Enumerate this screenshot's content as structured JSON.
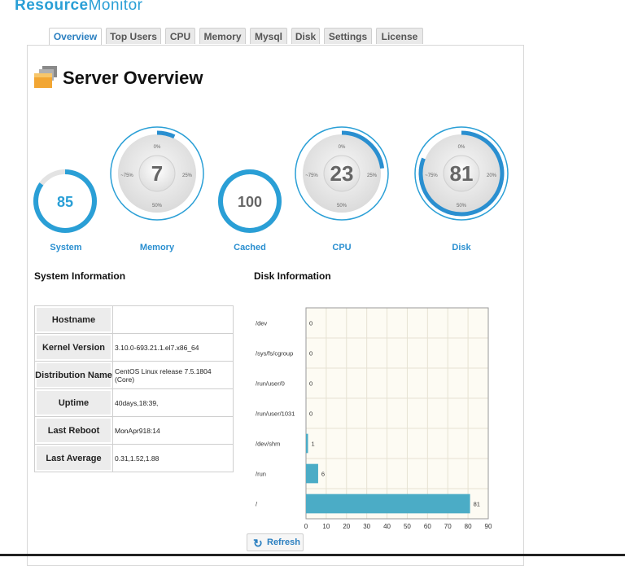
{
  "brand": {
    "part1": "Resource",
    "part2": "Monitor"
  },
  "tabs": [
    {
      "label": "Overview",
      "active": true
    },
    {
      "label": "Top Users",
      "active": false
    },
    {
      "label": "CPU",
      "active": false
    },
    {
      "label": "Memory",
      "active": false
    },
    {
      "label": "Mysql",
      "active": false
    },
    {
      "label": "Disk",
      "active": false
    },
    {
      "label": "Settings",
      "active": false
    },
    {
      "label": "License",
      "active": false
    }
  ],
  "page": {
    "title": "Server Overview",
    "icon": "folders-icon"
  },
  "gauges": [
    {
      "label": "System",
      "value": "85",
      "percent": 85,
      "style": "ring"
    },
    {
      "label": "Memory",
      "value": "7",
      "percent": 7,
      "style": "dial",
      "ticks": [
        "0%",
        "25%",
        "50%",
        "~75%"
      ]
    },
    {
      "label": "Cached",
      "value": "100",
      "percent": 100,
      "style": "ring"
    },
    {
      "label": "CPU",
      "value": "23",
      "percent": 23,
      "style": "dial",
      "ticks": [
        "0%",
        "25%",
        "50%",
        "~75%"
      ]
    },
    {
      "label": "Disk",
      "value": "81",
      "percent": 81,
      "style": "dial",
      "ticks": [
        "0%",
        "20%",
        "50%",
        "~75%"
      ]
    }
  ],
  "colors": {
    "accent": "#2a9fd6",
    "bar": "#4bacc6",
    "tab_active_text": "#2a7fc0"
  },
  "system_info": {
    "heading": "System Information",
    "rows": [
      {
        "key": "Hostname",
        "value": ""
      },
      {
        "key": "Kernel Version",
        "value": "3.10.0-693.21.1.el7.x86_64"
      },
      {
        "key": "Distribution Name",
        "value": "CentOS Linux release 7.5.1804 (Core)"
      },
      {
        "key": "Uptime",
        "value": "40days,18:39,"
      },
      {
        "key": "Last Reboot",
        "value": "MonApr918:14"
      },
      {
        "key": "Last Average",
        "value": "0.31,1.52,1.88"
      }
    ]
  },
  "disk_info": {
    "heading": "Disk Information"
  },
  "chart_data": {
    "type": "bar",
    "orientation": "horizontal",
    "categories": [
      "/dev",
      "/sys/fs/cgroup",
      "/run/user/0",
      "/run/user/1031",
      "/dev/shm",
      "/run",
      "/"
    ],
    "values": [
      0,
      0,
      0,
      0,
      1,
      6,
      81
    ],
    "xlim": [
      0,
      90
    ],
    "xticks": [
      0,
      10,
      20,
      30,
      40,
      50,
      60,
      70,
      80,
      90
    ],
    "grid": true
  },
  "refresh": {
    "label": "Refresh",
    "icon": "refresh-icon"
  }
}
